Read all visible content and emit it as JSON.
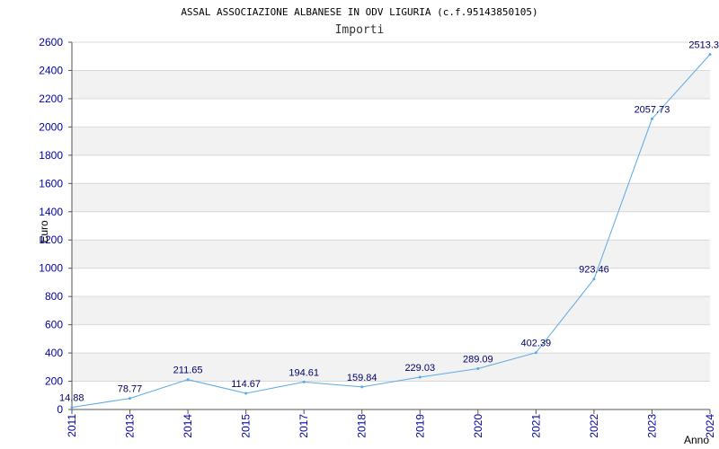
{
  "chart_data": {
    "type": "line",
    "title": "ASSAL ASSOCIAZIONE ALBANESE IN ODV LIGURIA (c.f.95143850105)",
    "subtitle": "Importi",
    "xlabel": "Anno",
    "ylabel": "Euro",
    "x": [
      "2011",
      "2013",
      "2014",
      "2015",
      "2017",
      "2018",
      "2019",
      "2020",
      "2021",
      "2022",
      "2023",
      "2024"
    ],
    "series": [
      {
        "values": [
          14.88,
          78.77,
          211.65,
          114.67,
          194.61,
          159.84,
          229.03,
          289.09,
          402.39,
          923.46,
          2057.73,
          2513.3
        ]
      }
    ],
    "data_labels": [
      "14.88",
      "78.77",
      "211.65",
      "114.67",
      "194.61",
      "159.84",
      "229.03",
      "289.09",
      "402.39",
      "923.46",
      "2057.73",
      "2513.3"
    ],
    "yticks": [
      "0",
      "200",
      "400",
      "600",
      "800",
      "1000",
      "1200",
      "1400",
      "1600",
      "1800",
      "2000",
      "2200",
      "2400",
      "2600"
    ],
    "ylim": [
      0,
      2600
    ],
    "grid": true,
    "legend": "none",
    "colors": {
      "line": "#5aaae6",
      "band": "#f2f2f2",
      "grid": "#d8d8d8",
      "tick_text": "#0000aa",
      "label_text": "#000066"
    }
  }
}
